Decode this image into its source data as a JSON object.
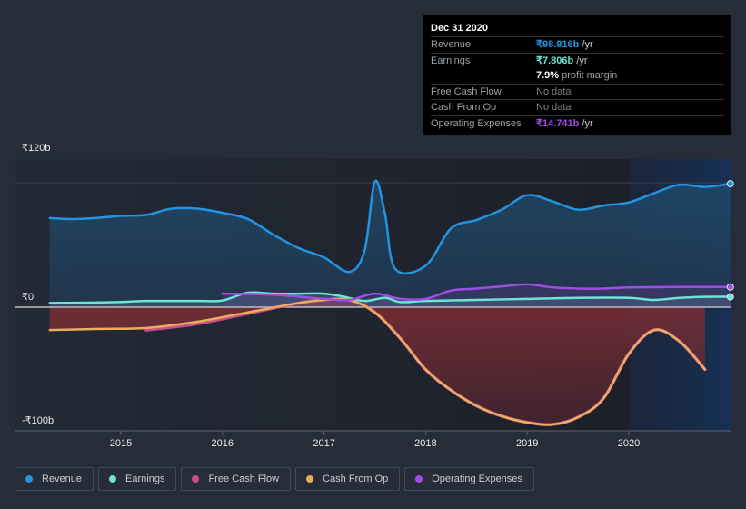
{
  "tooltip": {
    "date": "Dec 31 2020",
    "rows": [
      {
        "label": "Revenue",
        "value": "₹98.916b",
        "unit": " /yr",
        "color": "#2394df"
      },
      {
        "label": "Earnings",
        "value": "₹7.806b",
        "unit": " /yr",
        "color": "#6ce5d3"
      },
      {
        "label": "",
        "value": "7.9%",
        "unit": " profit margin",
        "color": "#ffffff"
      },
      {
        "label": "Free Cash Flow",
        "value": "No data",
        "unit": "",
        "color": "#7d8289"
      },
      {
        "label": "Cash From Op",
        "value": "No data",
        "unit": "",
        "color": "#7d8289"
      },
      {
        "label": "Operating Expenses",
        "value": "₹14.741b",
        "unit": " /yr",
        "color": "#a24ce6"
      }
    ]
  },
  "legend": [
    {
      "label": "Revenue",
      "color": "#2394df"
    },
    {
      "label": "Earnings",
      "color": "#6ce5d3"
    },
    {
      "label": "Free Cash Flow",
      "color": "#c84b8c"
    },
    {
      "label": "Cash From Op",
      "color": "#e9ad5c"
    },
    {
      "label": "Operating Expenses",
      "color": "#a24ce6"
    }
  ],
  "chart_data": {
    "type": "line",
    "title": "",
    "xlabel": "",
    "ylabel": "",
    "y_tick_labels": [
      "₹120b",
      "₹0",
      "-₹100b"
    ],
    "x_tick_labels": [
      "2015",
      "2016",
      "2017",
      "2018",
      "2019",
      "2020"
    ],
    "xlim": [
      2014.3,
      2021.0
    ],
    "ylim": [
      -120,
      120
    ],
    "highlight_region_start": 2020.0,
    "grid": true,
    "legend_position": "bottom",
    "series": [
      {
        "name": "Revenue",
        "color": "#2394df",
        "points": [
          [
            2014.3,
            86
          ],
          [
            2014.5,
            85
          ],
          [
            2014.75,
            86
          ],
          [
            2015.0,
            88
          ],
          [
            2015.25,
            89
          ],
          [
            2015.5,
            95
          ],
          [
            2015.75,
            95
          ],
          [
            2016.0,
            91
          ],
          [
            2016.25,
            85
          ],
          [
            2016.5,
            70
          ],
          [
            2016.75,
            57
          ],
          [
            2017.0,
            48
          ],
          [
            2017.25,
            34
          ],
          [
            2017.4,
            55
          ],
          [
            2017.5,
            121
          ],
          [
            2017.6,
            90
          ],
          [
            2017.7,
            37
          ],
          [
            2018.0,
            40
          ],
          [
            2018.25,
            76
          ],
          [
            2018.5,
            84
          ],
          [
            2018.75,
            94
          ],
          [
            2019.0,
            108
          ],
          [
            2019.25,
            102
          ],
          [
            2019.5,
            94
          ],
          [
            2019.75,
            98
          ],
          [
            2020.0,
            101
          ],
          [
            2020.25,
            110
          ],
          [
            2020.5,
            118
          ],
          [
            2020.75,
            116
          ],
          [
            2021.0,
            119
          ]
        ]
      },
      {
        "name": "Earnings",
        "color": "#6ce5d3",
        "points": [
          [
            2014.3,
            4
          ],
          [
            2014.75,
            4.5
          ],
          [
            2015.0,
            5
          ],
          [
            2015.25,
            6
          ],
          [
            2015.75,
            6
          ],
          [
            2016.0,
            6.5
          ],
          [
            2016.25,
            14
          ],
          [
            2016.5,
            13
          ],
          [
            2016.75,
            13
          ],
          [
            2017.0,
            13
          ],
          [
            2017.2,
            10
          ],
          [
            2017.4,
            6
          ],
          [
            2017.6,
            9
          ],
          [
            2017.75,
            5
          ],
          [
            2018.0,
            6
          ],
          [
            2018.5,
            7
          ],
          [
            2019.0,
            8
          ],
          [
            2019.5,
            9
          ],
          [
            2020.0,
            9
          ],
          [
            2020.25,
            7
          ],
          [
            2020.5,
            9
          ],
          [
            2020.75,
            10
          ],
          [
            2021.0,
            10
          ]
        ]
      },
      {
        "name": "Free Cash Flow",
        "color": "#c84b8c",
        "points": [
          [
            2015.25,
            -22
          ],
          [
            2015.75,
            -16
          ],
          [
            2016.25,
            -6
          ],
          [
            2016.75,
            4
          ],
          [
            2017.0,
            7
          ],
          [
            2017.25,
            7
          ],
          [
            2017.5,
            -5
          ],
          [
            2017.75,
            -30
          ],
          [
            2018.0,
            -60
          ],
          [
            2018.25,
            -80
          ],
          [
            2018.5,
            -95
          ],
          [
            2018.75,
            -105
          ],
          [
            2019.0,
            -111
          ],
          [
            2019.25,
            -113
          ],
          [
            2019.5,
            -106
          ],
          [
            2019.75,
            -88
          ],
          [
            2020.0,
            -45
          ],
          [
            2020.25,
            -22
          ],
          [
            2020.5,
            -33
          ],
          [
            2020.75,
            -60
          ]
        ]
      },
      {
        "name": "Cash From Op",
        "color": "#e9ad5c",
        "points": [
          [
            2014.3,
            -22
          ],
          [
            2014.75,
            -21
          ],
          [
            2015.25,
            -20
          ],
          [
            2015.75,
            -14
          ],
          [
            2016.25,
            -5
          ],
          [
            2016.75,
            4
          ],
          [
            2017.0,
            7
          ],
          [
            2017.25,
            7
          ],
          [
            2017.5,
            -5
          ],
          [
            2017.75,
            -30
          ],
          [
            2018.0,
            -60
          ],
          [
            2018.25,
            -80
          ],
          [
            2018.5,
            -95
          ],
          [
            2018.75,
            -105
          ],
          [
            2019.0,
            -111
          ],
          [
            2019.25,
            -113
          ],
          [
            2019.5,
            -106
          ],
          [
            2019.75,
            -88
          ],
          [
            2020.0,
            -45
          ],
          [
            2020.25,
            -22
          ],
          [
            2020.5,
            -33
          ],
          [
            2020.75,
            -60
          ]
        ]
      },
      {
        "name": "Operating Expenses",
        "color": "#a24ce6",
        "points": [
          [
            2016.0,
            13
          ],
          [
            2016.5,
            12
          ],
          [
            2017.0,
            8
          ],
          [
            2017.25,
            7
          ],
          [
            2017.5,
            13
          ],
          [
            2017.75,
            8
          ],
          [
            2018.0,
            8
          ],
          [
            2018.25,
            16
          ],
          [
            2018.5,
            18
          ],
          [
            2018.75,
            20
          ],
          [
            2019.0,
            22
          ],
          [
            2019.25,
            19
          ],
          [
            2019.5,
            18
          ],
          [
            2019.75,
            18
          ],
          [
            2020.0,
            19
          ],
          [
            2020.5,
            19.5
          ],
          [
            2021.0,
            19.5
          ]
        ]
      }
    ]
  }
}
